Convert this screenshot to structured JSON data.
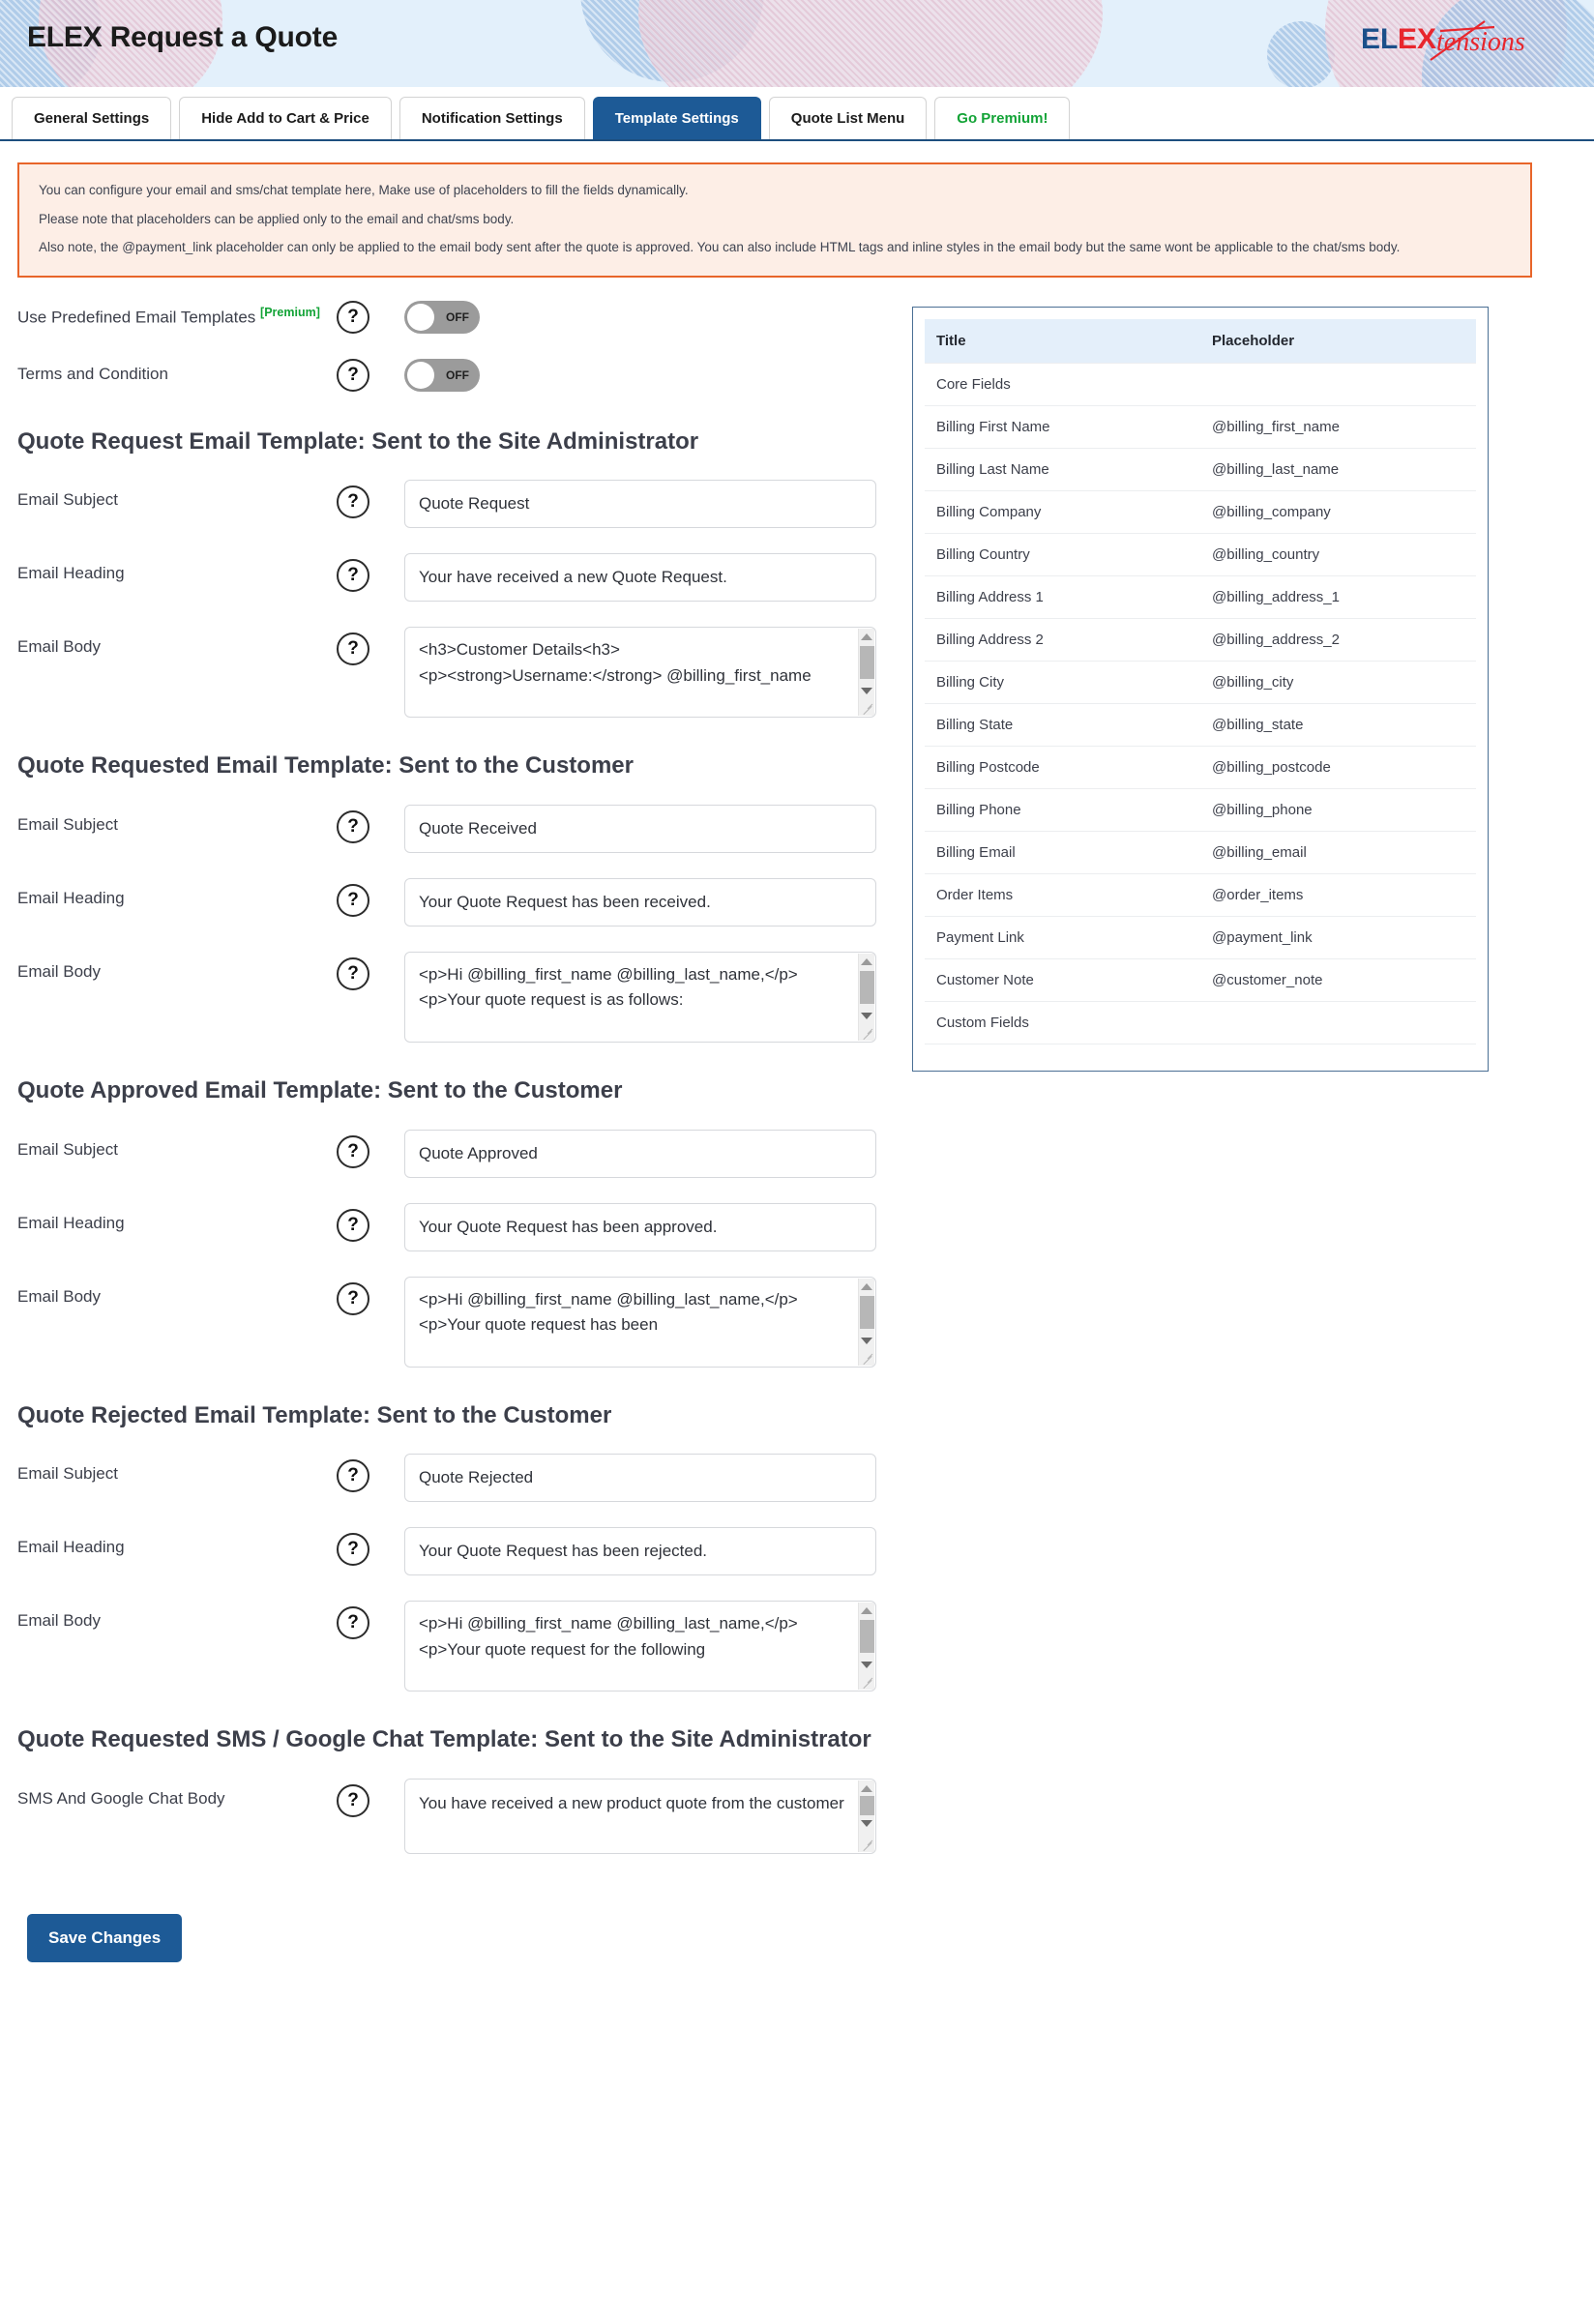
{
  "header": {
    "title": "ELEX Request a Quote",
    "logo": {
      "part1": "EL",
      "part2": "EX",
      "part3": "tensions"
    },
    "colors": {
      "logo_blue": "#1b4f8a",
      "logo_red": "#e8262d",
      "header_bg": "#e3f0fb"
    }
  },
  "tabs": [
    {
      "label": "General Settings",
      "active": false,
      "premium": false
    },
    {
      "label": "Hide Add to Cart & Price",
      "active": false,
      "premium": false
    },
    {
      "label": "Notification Settings",
      "active": false,
      "premium": false
    },
    {
      "label": "Template Settings",
      "active": true,
      "premium": false
    },
    {
      "label": "Quote List Menu",
      "active": false,
      "premium": false
    },
    {
      "label": "Go Premium!",
      "active": false,
      "premium": true
    }
  ],
  "notice": {
    "lines": [
      "You can configure your email and sms/chat template here, Make use of placeholders to fill the fields dynamically.",
      "Please note that placeholders can be applied only to the email and chat/sms body.",
      "Also note, the @payment_link placeholder can only be applied to the email body sent after the quote is approved. You can also include HTML tags and inline styles in the email body but the same wont be applicable to the chat/sms body."
    ],
    "border_color": "#e8652a",
    "bg_color": "#fdeee6"
  },
  "toggles": [
    {
      "label": "Use Predefined Email Templates",
      "badge": "[Premium]",
      "state": "OFF",
      "help": "?"
    },
    {
      "label": "Terms and Condition",
      "badge": "",
      "state": "OFF",
      "help": "?"
    }
  ],
  "sections": [
    {
      "title": "Quote Request Email Template: Sent to the Site Administrator",
      "subject_label": "Email Subject",
      "subject_value": "Quote Request",
      "heading_label": "Email Heading",
      "heading_value": "Your have received a new Quote Request.",
      "body_label": "Email Body",
      "body_value": "<h3>Customer Details<h3>\n<p><strong>Username:</strong> @billing_first_name"
    },
    {
      "title": "Quote Requested Email Template: Sent to the Customer",
      "subject_label": "Email Subject",
      "subject_value": "Quote Received",
      "heading_label": "Email Heading",
      "heading_value": "Your Quote Request has been received.",
      "body_label": "Email Body",
      "body_value": "<p>Hi @billing_first_name @billing_last_name,</p>\n<p>Your quote request is as follows:"
    },
    {
      "title": "Quote Approved Email Template: Sent to the Customer",
      "subject_label": "Email Subject",
      "subject_value": "Quote Approved",
      "heading_label": "Email Heading",
      "heading_value": "Your Quote Request has been approved.",
      "body_label": "Email Body",
      "body_value": "<p>Hi @billing_first_name @billing_last_name,</p>\n<p>Your quote request has been"
    },
    {
      "title": "Quote Rejected Email Template: Sent to the Customer",
      "subject_label": "Email Subject",
      "subject_value": "Quote Rejected",
      "heading_label": "Email Heading",
      "heading_value": "Your Quote Request has been rejected.",
      "body_label": "Email Body",
      "body_value": "<p>Hi @billing_first_name @billing_last_name,</p>\n<p>Your quote request for the following"
    }
  ],
  "sms_section": {
    "title": "Quote Requested SMS / Google Chat Template: Sent to the Site Administrator",
    "body_label": "SMS And Google Chat Body",
    "body_value": "You have received a new product quote from the customer"
  },
  "placeholder_table": {
    "columns": [
      "Title",
      "Placeholder"
    ],
    "rows": [
      {
        "title": "Core Fields",
        "placeholder": ""
      },
      {
        "title": "Billing First Name",
        "placeholder": "@billing_first_name"
      },
      {
        "title": "Billing Last Name",
        "placeholder": "@billing_last_name"
      },
      {
        "title": "Billing Company",
        "placeholder": "@billing_company"
      },
      {
        "title": "Billing Country",
        "placeholder": "@billing_country"
      },
      {
        "title": "Billing Address 1",
        "placeholder": "@billing_address_1"
      },
      {
        "title": "Billing Address 2",
        "placeholder": "@billing_address_2"
      },
      {
        "title": "Billing City",
        "placeholder": "@billing_city"
      },
      {
        "title": "Billing State",
        "placeholder": "@billing_state"
      },
      {
        "title": "Billing Postcode",
        "placeholder": "@billing_postcode"
      },
      {
        "title": "Billing Phone",
        "placeholder": "@billing_phone"
      },
      {
        "title": "Billing Email",
        "placeholder": "@billing_email"
      },
      {
        "title": "Order Items",
        "placeholder": "@order_items"
      },
      {
        "title": "Payment Link",
        "placeholder": "@payment_link"
      },
      {
        "title": "Customer Note",
        "placeholder": "@customer_note"
      },
      {
        "title": "Custom Fields",
        "placeholder": ""
      }
    ]
  },
  "save": {
    "label": "Save Changes",
    "color": "#1d5a96"
  }
}
